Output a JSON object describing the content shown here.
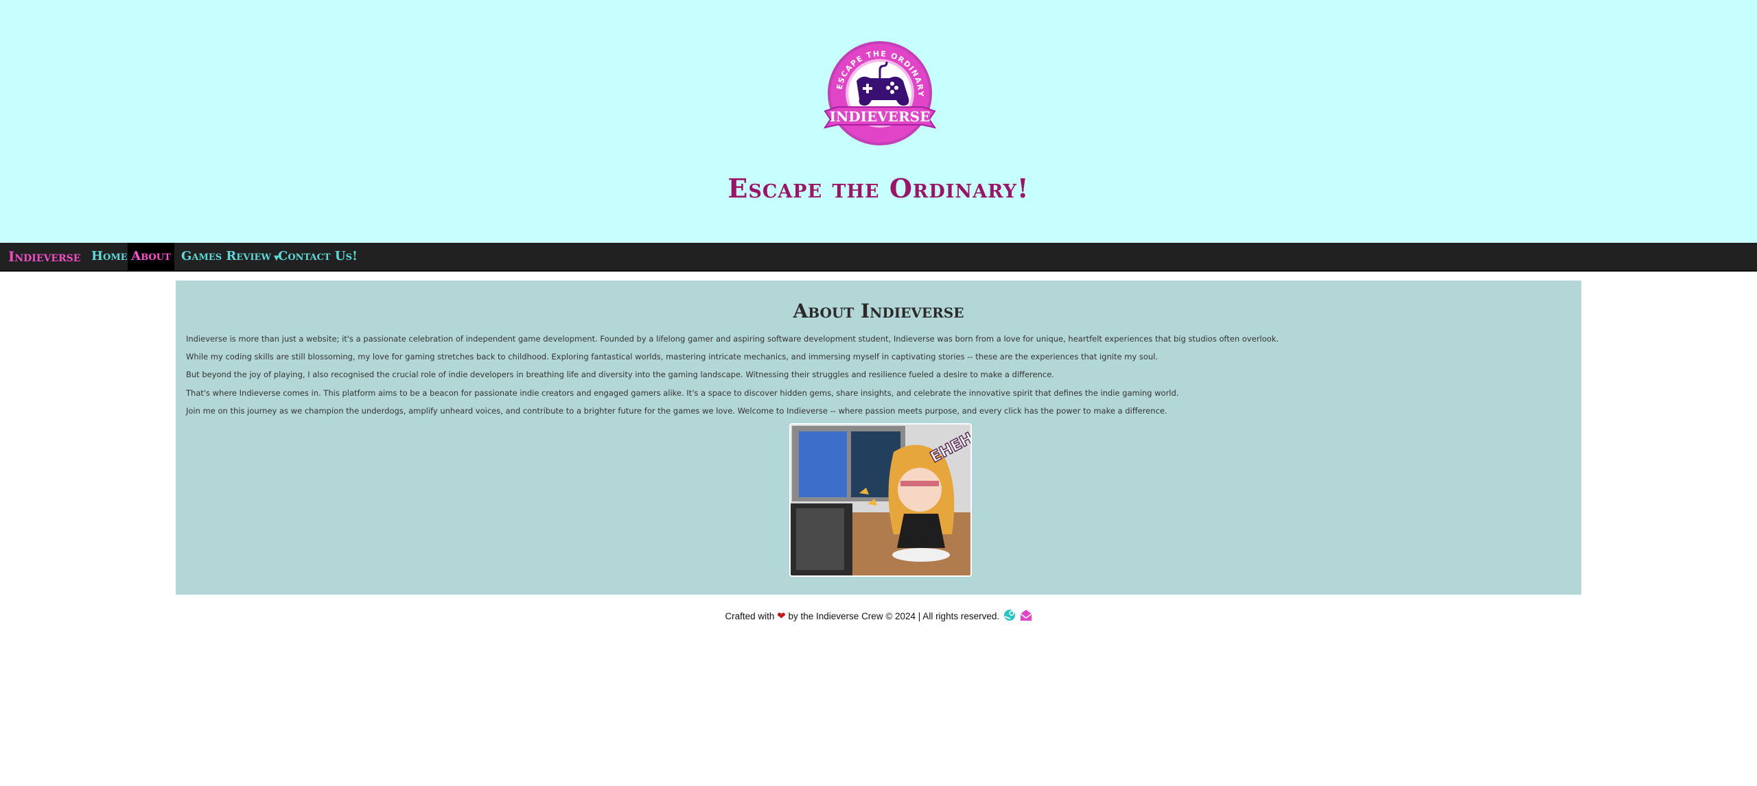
{
  "header": {
    "logo": {
      "arc_text": "ESCAPE THE ORDINARY",
      "brand_text": "INDIEVERSE",
      "colors": {
        "ring": "#e244c7",
        "inner": "#a51fa0",
        "controller": "#3a0f74"
      }
    },
    "tagline": "Escape the Ordinary!"
  },
  "nav": {
    "brand": "Indieverse",
    "items": [
      {
        "label": "Home",
        "active": false
      },
      {
        "label": "About",
        "active": true
      },
      {
        "label": "Games Review",
        "has_dropdown": true,
        "active": false
      },
      {
        "label": "Contact Us!",
        "active": false
      }
    ]
  },
  "about": {
    "title": "About Indieverse",
    "paragraphs": [
      "Indieverse is more than just a website; it's a passionate celebration of independent game development. Founded by a lifelong gamer and aspiring software development student, Indieverse was born from a love for unique, heartfelt experiences that big studios often overlook.",
      "While my coding skills are still blossoming, my love for gaming stretches back to childhood. Exploring fantastical worlds, mastering intricate mechanics, and immersing myself in captivating stories -- these are the experiences that ignite my soul.",
      "But beyond the joy of playing, I also recognised the crucial role of indie developers in breathing life and diversity into the gaming landscape. Witnessing their struggles and resilience fueled a desire to make a difference.",
      "That's where Indieverse comes in. This platform aims to be a beacon for passionate indie creators and engaged gamers alike. It's a space to discover hidden gems, share insights, and celebrate the innovative spirit that defines the indie gaming world.",
      "Join me on this journey as we champion the underdogs, amplify unheard voices, and contribute to a brighter future for the games we love. Welcome to Indieverse -- where passion meets purpose, and every click has the power to make a difference."
    ],
    "image_sound_text": "EHEH"
  },
  "footer": {
    "prefix": "Crafted with",
    "suffix": "by the Indieverse Crew © 2024 | All rights reserved.",
    "icons": [
      "heart-icon",
      "steam-icon",
      "email-icon"
    ]
  },
  "colors": {
    "header_bg": "#c7ffff",
    "nav_bg": "#212121",
    "nav_link": "#5fd8d8",
    "nav_brand": "#f04ec7",
    "tagline": "#9b1467",
    "content_bg": "#b3d6d7"
  }
}
